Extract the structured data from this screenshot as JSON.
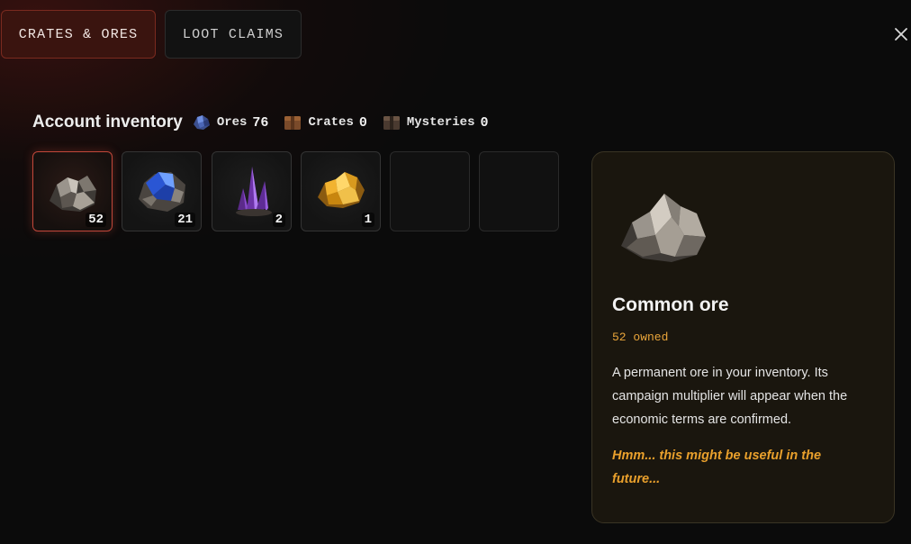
{
  "tabs": [
    {
      "label": "CRATES & ORES",
      "active": true
    },
    {
      "label": "LOOT CLAIMS",
      "active": false
    }
  ],
  "inventory": {
    "title": "Account inventory",
    "stats": [
      {
        "label": "Ores",
        "value": "76",
        "icon": "ore-icon"
      },
      {
        "label": "Crates",
        "value": "0",
        "icon": "crate-icon"
      },
      {
        "label": "Mysteries",
        "value": "0",
        "icon": "mystery-crate-icon"
      }
    ],
    "slots": [
      {
        "item": "common-ore",
        "count": "52",
        "selected": true
      },
      {
        "item": "blue-ore",
        "count": "21",
        "selected": false
      },
      {
        "item": "purple-crystal",
        "count": "2",
        "selected": false
      },
      {
        "item": "gold-ore",
        "count": "1",
        "selected": false
      },
      {
        "item": "",
        "count": "",
        "selected": false
      },
      {
        "item": "",
        "count": "",
        "selected": false
      }
    ]
  },
  "detail": {
    "title": "Common ore",
    "owned": "52 owned",
    "description": "A permanent ore in your inventory. Its campaign multiplier will appear when the economic terms are confirmed.",
    "flavor": "Hmm... this might be useful in the future..."
  },
  "colors": {
    "accent": "#c2473a",
    "gold": "#e9a53a",
    "panel_bg": "#1a160e",
    "background": "#0b0b0b"
  }
}
